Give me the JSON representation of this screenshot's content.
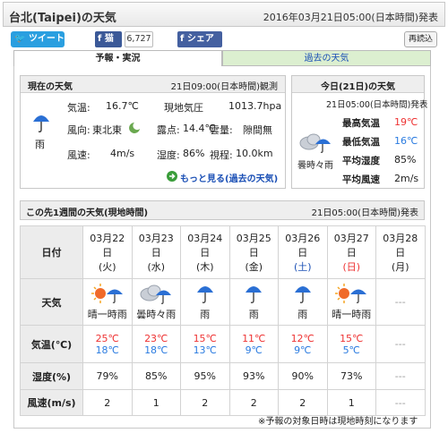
{
  "header": {
    "title": "台北(Taipei)の天気",
    "datetime": "2016年03月21日05:00(日本時間)発表"
  },
  "social": {
    "tweet": "ツイート",
    "fb_like": "猫",
    "fb_count": "6,727",
    "share": "シェア",
    "reload": "再読込"
  },
  "tabs": [
    {
      "label": "予報・実況"
    },
    {
      "label": "過去の天気"
    }
  ],
  "current": {
    "header": "現在の天気",
    "observed": "21日09:00(日本時間)観測",
    "condition": "雨",
    "temp_label": "気温:",
    "temp_value": "16.7℃",
    "pressure_label": "現地気圧",
    "pressure_value": "1013.7hpa",
    "wind_dir_label": "風向:",
    "wind_dir_value": "東北東",
    "dew_label": "露点:",
    "dew_value": "14.4℃",
    "cloud_label": "雲量:",
    "cloud_value": "隙間無",
    "wind_speed_label": "風速:",
    "wind_speed_value": "4m/s",
    "humidity_label": "湿度:",
    "humidity_value": "86%",
    "visibility_label": "視程:",
    "visibility_value": "10.0km",
    "more_link": "もっと見る(過去の天気)"
  },
  "today": {
    "header": "今日(21日)の天気",
    "issued": "21日05:00(日本時間)発表",
    "condition": "曇時々雨",
    "max_label": "最高気温",
    "max_value": "19℃",
    "min_label": "最低気温",
    "min_value": "16℃",
    "humidity_label": "平均湿度",
    "humidity_value": "85%",
    "wind_label": "平均風速",
    "wind_value": "2m/s"
  },
  "week": {
    "header": "この先1週間の天気(現地時間)",
    "issued": "21日05:00(日本時間)発表",
    "row_labels": {
      "date": "日付",
      "weather": "天気",
      "temp": "気温(℃)",
      "humidity": "湿度(%)",
      "wind": "風速(m/s)"
    },
    "days": [
      {
        "date": "03月22",
        "day": "日",
        "dow": "(火)",
        "weather": "晴一時雨",
        "icon": "sun-umbrella-icon",
        "max": "25℃",
        "min": "18℃",
        "humidity": "79%",
        "wind": "2"
      },
      {
        "date": "03月23",
        "day": "日",
        "dow": "(水)",
        "weather": "曇時々雨",
        "icon": "cloud-umbrella-icon",
        "max": "23℃",
        "min": "18℃",
        "humidity": "85%",
        "wind": "1"
      },
      {
        "date": "03月24",
        "day": "日",
        "dow": "(木)",
        "weather": "雨",
        "icon": "umbrella-icon",
        "max": "15℃",
        "min": "13℃",
        "humidity": "95%",
        "wind": "2"
      },
      {
        "date": "03月25",
        "day": "日",
        "dow": "(金)",
        "weather": "雨",
        "icon": "umbrella-icon",
        "max": "11℃",
        "min": "9℃",
        "humidity": "93%",
        "wind": "2"
      },
      {
        "date": "03月26",
        "day": "日",
        "dow": "(土)",
        "weather": "雨",
        "icon": "umbrella-icon",
        "max": "12℃",
        "min": "9℃",
        "humidity": "90%",
        "wind": "2"
      },
      {
        "date": "03月27",
        "day": "日",
        "dow": "(日)",
        "weather": "晴一時雨",
        "icon": "sun-umbrella-icon",
        "max": "15℃",
        "min": "5℃",
        "humidity": "73%",
        "wind": "1"
      },
      {
        "date": "03月28",
        "day": "日",
        "dow": "(月)",
        "weather": "",
        "icon": "",
        "max": "",
        "min": "",
        "humidity": "",
        "wind": ""
      }
    ],
    "dash": "---",
    "footnote": "※予報の対象日時は現地時刻になります"
  },
  "colors": {
    "sat": "#1a4fb5",
    "sun": "#e33",
    "max": "#e33",
    "min": "#2a7be0"
  }
}
